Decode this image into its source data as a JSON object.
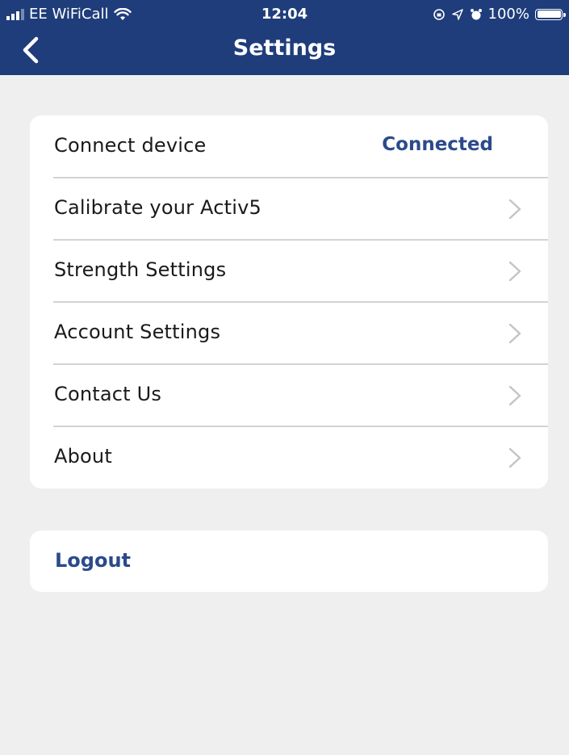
{
  "status_bar": {
    "carrier": "EE WiFiCall",
    "time": "12:04",
    "battery": "100%"
  },
  "nav": {
    "title": "Settings"
  },
  "menu": {
    "items": [
      {
        "label": "Connect device",
        "value": "Connected"
      },
      {
        "label": "Calibrate your Activ5"
      },
      {
        "label": "Strength Settings"
      },
      {
        "label": "Account Settings"
      },
      {
        "label": "Contact Us"
      },
      {
        "label": "About"
      }
    ]
  },
  "logout": {
    "label": "Logout"
  },
  "colors": {
    "header": "#1f3d7a",
    "accent": "#2b4a8b",
    "background": "#efefef"
  }
}
